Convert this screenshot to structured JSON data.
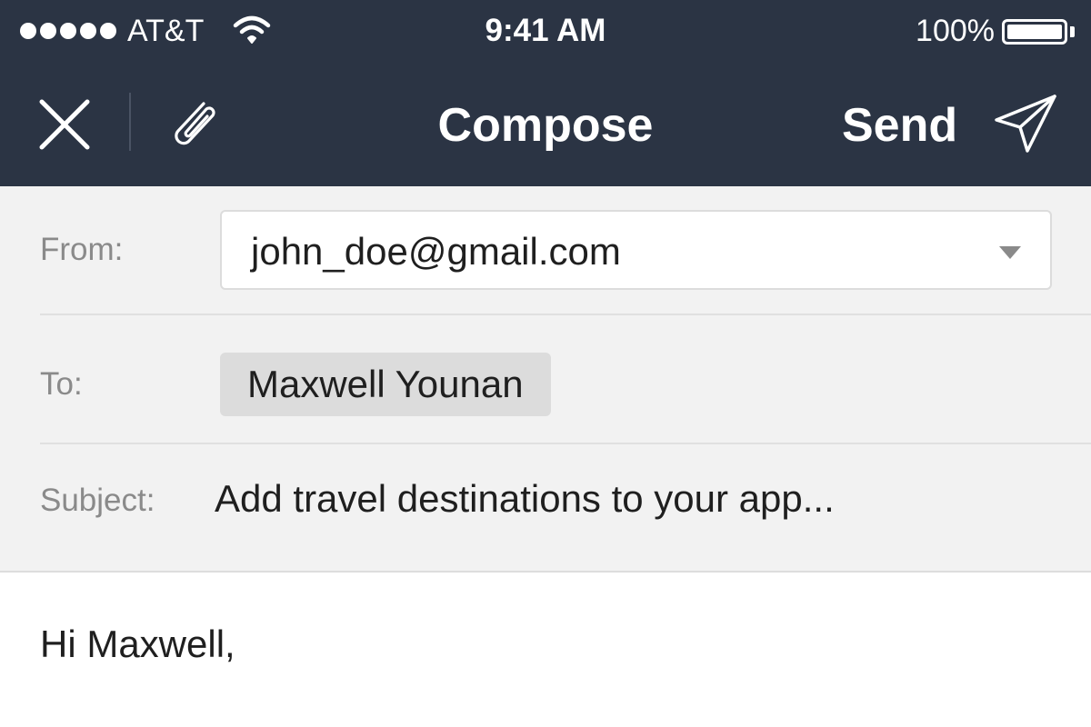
{
  "status_bar": {
    "carrier": "AT&T",
    "time": "9:41 AM",
    "battery": "100%",
    "signal_bars": 5,
    "icons": [
      "signal-dots-icon",
      "wifi-icon",
      "battery-icon"
    ]
  },
  "nav_bar": {
    "title": "Compose",
    "send_label": "Send",
    "icons": [
      "close-icon",
      "paperclip-icon",
      "paper-plane-icon"
    ],
    "background_color": "#2b3444"
  },
  "form": {
    "from_label": "From:",
    "from_value": "john_doe@gmail.com",
    "to_label": "To:",
    "to_recipients": [
      "Maxwell Younan"
    ],
    "subject_label": "Subject:",
    "subject_value": "Add travel destinations to your app..."
  },
  "message": {
    "body": "Hi Maxwell,"
  }
}
